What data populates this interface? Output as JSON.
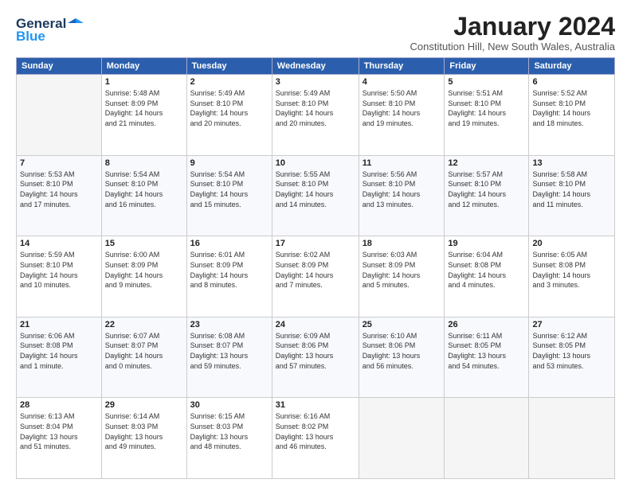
{
  "header": {
    "logo_general": "General",
    "logo_blue": "Blue",
    "title": "January 2024",
    "subtitle": "Constitution Hill, New South Wales, Australia"
  },
  "days_of_week": [
    "Sunday",
    "Monday",
    "Tuesday",
    "Wednesday",
    "Thursday",
    "Friday",
    "Saturday"
  ],
  "weeks": [
    [
      {
        "day": "",
        "info": ""
      },
      {
        "day": "1",
        "info": "Sunrise: 5:48 AM\nSunset: 8:09 PM\nDaylight: 14 hours\nand 21 minutes."
      },
      {
        "day": "2",
        "info": "Sunrise: 5:49 AM\nSunset: 8:10 PM\nDaylight: 14 hours\nand 20 minutes."
      },
      {
        "day": "3",
        "info": "Sunrise: 5:49 AM\nSunset: 8:10 PM\nDaylight: 14 hours\nand 20 minutes."
      },
      {
        "day": "4",
        "info": "Sunrise: 5:50 AM\nSunset: 8:10 PM\nDaylight: 14 hours\nand 19 minutes."
      },
      {
        "day": "5",
        "info": "Sunrise: 5:51 AM\nSunset: 8:10 PM\nDaylight: 14 hours\nand 19 minutes."
      },
      {
        "day": "6",
        "info": "Sunrise: 5:52 AM\nSunset: 8:10 PM\nDaylight: 14 hours\nand 18 minutes."
      }
    ],
    [
      {
        "day": "7",
        "info": "Sunrise: 5:53 AM\nSunset: 8:10 PM\nDaylight: 14 hours\nand 17 minutes."
      },
      {
        "day": "8",
        "info": "Sunrise: 5:54 AM\nSunset: 8:10 PM\nDaylight: 14 hours\nand 16 minutes."
      },
      {
        "day": "9",
        "info": "Sunrise: 5:54 AM\nSunset: 8:10 PM\nDaylight: 14 hours\nand 15 minutes."
      },
      {
        "day": "10",
        "info": "Sunrise: 5:55 AM\nSunset: 8:10 PM\nDaylight: 14 hours\nand 14 minutes."
      },
      {
        "day": "11",
        "info": "Sunrise: 5:56 AM\nSunset: 8:10 PM\nDaylight: 14 hours\nand 13 minutes."
      },
      {
        "day": "12",
        "info": "Sunrise: 5:57 AM\nSunset: 8:10 PM\nDaylight: 14 hours\nand 12 minutes."
      },
      {
        "day": "13",
        "info": "Sunrise: 5:58 AM\nSunset: 8:10 PM\nDaylight: 14 hours\nand 11 minutes."
      }
    ],
    [
      {
        "day": "14",
        "info": "Sunrise: 5:59 AM\nSunset: 8:10 PM\nDaylight: 14 hours\nand 10 minutes."
      },
      {
        "day": "15",
        "info": "Sunrise: 6:00 AM\nSunset: 8:09 PM\nDaylight: 14 hours\nand 9 minutes."
      },
      {
        "day": "16",
        "info": "Sunrise: 6:01 AM\nSunset: 8:09 PM\nDaylight: 14 hours\nand 8 minutes."
      },
      {
        "day": "17",
        "info": "Sunrise: 6:02 AM\nSunset: 8:09 PM\nDaylight: 14 hours\nand 7 minutes."
      },
      {
        "day": "18",
        "info": "Sunrise: 6:03 AM\nSunset: 8:09 PM\nDaylight: 14 hours\nand 5 minutes."
      },
      {
        "day": "19",
        "info": "Sunrise: 6:04 AM\nSunset: 8:08 PM\nDaylight: 14 hours\nand 4 minutes."
      },
      {
        "day": "20",
        "info": "Sunrise: 6:05 AM\nSunset: 8:08 PM\nDaylight: 14 hours\nand 3 minutes."
      }
    ],
    [
      {
        "day": "21",
        "info": "Sunrise: 6:06 AM\nSunset: 8:08 PM\nDaylight: 14 hours\nand 1 minute."
      },
      {
        "day": "22",
        "info": "Sunrise: 6:07 AM\nSunset: 8:07 PM\nDaylight: 14 hours\nand 0 minutes."
      },
      {
        "day": "23",
        "info": "Sunrise: 6:08 AM\nSunset: 8:07 PM\nDaylight: 13 hours\nand 59 minutes."
      },
      {
        "day": "24",
        "info": "Sunrise: 6:09 AM\nSunset: 8:06 PM\nDaylight: 13 hours\nand 57 minutes."
      },
      {
        "day": "25",
        "info": "Sunrise: 6:10 AM\nSunset: 8:06 PM\nDaylight: 13 hours\nand 56 minutes."
      },
      {
        "day": "26",
        "info": "Sunrise: 6:11 AM\nSunset: 8:05 PM\nDaylight: 13 hours\nand 54 minutes."
      },
      {
        "day": "27",
        "info": "Sunrise: 6:12 AM\nSunset: 8:05 PM\nDaylight: 13 hours\nand 53 minutes."
      }
    ],
    [
      {
        "day": "28",
        "info": "Sunrise: 6:13 AM\nSunset: 8:04 PM\nDaylight: 13 hours\nand 51 minutes."
      },
      {
        "day": "29",
        "info": "Sunrise: 6:14 AM\nSunset: 8:03 PM\nDaylight: 13 hours\nand 49 minutes."
      },
      {
        "day": "30",
        "info": "Sunrise: 6:15 AM\nSunset: 8:03 PM\nDaylight: 13 hours\nand 48 minutes."
      },
      {
        "day": "31",
        "info": "Sunrise: 6:16 AM\nSunset: 8:02 PM\nDaylight: 13 hours\nand 46 minutes."
      },
      {
        "day": "",
        "info": ""
      },
      {
        "day": "",
        "info": ""
      },
      {
        "day": "",
        "info": ""
      }
    ]
  ]
}
